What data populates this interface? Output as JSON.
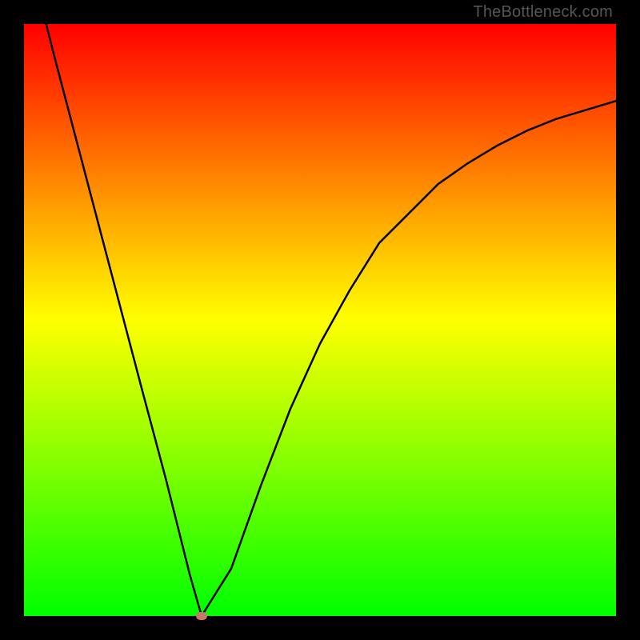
{
  "watermark": "TheBottleneck.com",
  "chart_data": {
    "type": "line",
    "title": "",
    "xlabel": "",
    "ylabel": "",
    "xlim": [
      0,
      100
    ],
    "ylim": [
      0,
      100
    ],
    "grid": false,
    "gradient": {
      "direction": "vertical",
      "stops": [
        {
          "y": 0,
          "color": "#00ff00"
        },
        {
          "y": 10,
          "color": "#33ff00"
        },
        {
          "y": 20,
          "color": "#66ff00"
        },
        {
          "y": 30,
          "color": "#8fff00"
        },
        {
          "y": 50,
          "color": "#ffff00"
        },
        {
          "y": 70,
          "color": "#ff9900"
        },
        {
          "y": 90,
          "color": "#ff3300"
        },
        {
          "y": 100,
          "color": "#ff0033"
        }
      ]
    },
    "series": [
      {
        "name": "bottleneck-curve",
        "x": [
          0,
          5,
          10,
          15,
          20,
          24,
          26,
          28,
          30,
          35,
          40,
          45,
          50,
          55,
          60,
          65,
          70,
          75,
          80,
          85,
          90,
          95,
          100
        ],
        "values": [
          115,
          95,
          76,
          57,
          38,
          23,
          15,
          7,
          0,
          8,
          22,
          35,
          46,
          55,
          63,
          68,
          73,
          76.5,
          79.5,
          82,
          84,
          85.5,
          87
        ]
      }
    ],
    "annotations": [
      {
        "name": "minimum-marker",
        "x": 30,
        "y": 0,
        "color": "#c8786a"
      }
    ]
  }
}
